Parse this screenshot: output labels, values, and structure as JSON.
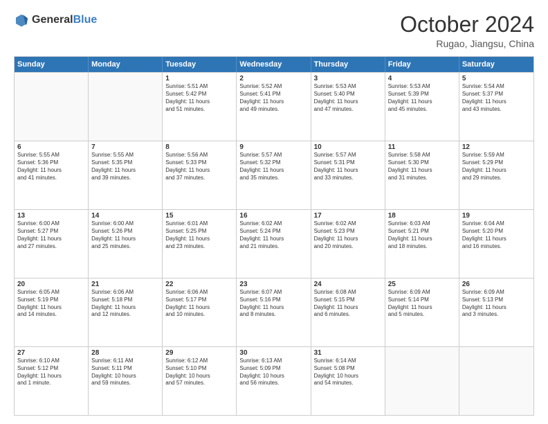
{
  "header": {
    "logo": {
      "general": "General",
      "blue": "Blue"
    },
    "title": "October 2024",
    "location": "Rugao, Jiangsu, China"
  },
  "calendar": {
    "weekdays": [
      "Sunday",
      "Monday",
      "Tuesday",
      "Wednesday",
      "Thursday",
      "Friday",
      "Saturday"
    ],
    "rows": [
      [
        {
          "day": "",
          "empty": true,
          "text": ""
        },
        {
          "day": "",
          "empty": true,
          "text": ""
        },
        {
          "day": "1",
          "text": "Sunrise: 5:51 AM\nSunset: 5:42 PM\nDaylight: 11 hours\nand 51 minutes."
        },
        {
          "day": "2",
          "text": "Sunrise: 5:52 AM\nSunset: 5:41 PM\nDaylight: 11 hours\nand 49 minutes."
        },
        {
          "day": "3",
          "text": "Sunrise: 5:53 AM\nSunset: 5:40 PM\nDaylight: 11 hours\nand 47 minutes."
        },
        {
          "day": "4",
          "text": "Sunrise: 5:53 AM\nSunset: 5:39 PM\nDaylight: 11 hours\nand 45 minutes."
        },
        {
          "day": "5",
          "text": "Sunrise: 5:54 AM\nSunset: 5:37 PM\nDaylight: 11 hours\nand 43 minutes."
        }
      ],
      [
        {
          "day": "6",
          "text": "Sunrise: 5:55 AM\nSunset: 5:36 PM\nDaylight: 11 hours\nand 41 minutes."
        },
        {
          "day": "7",
          "text": "Sunrise: 5:55 AM\nSunset: 5:35 PM\nDaylight: 11 hours\nand 39 minutes."
        },
        {
          "day": "8",
          "text": "Sunrise: 5:56 AM\nSunset: 5:33 PM\nDaylight: 11 hours\nand 37 minutes."
        },
        {
          "day": "9",
          "text": "Sunrise: 5:57 AM\nSunset: 5:32 PM\nDaylight: 11 hours\nand 35 minutes."
        },
        {
          "day": "10",
          "text": "Sunrise: 5:57 AM\nSunset: 5:31 PM\nDaylight: 11 hours\nand 33 minutes."
        },
        {
          "day": "11",
          "text": "Sunrise: 5:58 AM\nSunset: 5:30 PM\nDaylight: 11 hours\nand 31 minutes."
        },
        {
          "day": "12",
          "text": "Sunrise: 5:59 AM\nSunset: 5:29 PM\nDaylight: 11 hours\nand 29 minutes."
        }
      ],
      [
        {
          "day": "13",
          "text": "Sunrise: 6:00 AM\nSunset: 5:27 PM\nDaylight: 11 hours\nand 27 minutes."
        },
        {
          "day": "14",
          "text": "Sunrise: 6:00 AM\nSunset: 5:26 PM\nDaylight: 11 hours\nand 25 minutes."
        },
        {
          "day": "15",
          "text": "Sunrise: 6:01 AM\nSunset: 5:25 PM\nDaylight: 11 hours\nand 23 minutes."
        },
        {
          "day": "16",
          "text": "Sunrise: 6:02 AM\nSunset: 5:24 PM\nDaylight: 11 hours\nand 21 minutes."
        },
        {
          "day": "17",
          "text": "Sunrise: 6:02 AM\nSunset: 5:23 PM\nDaylight: 11 hours\nand 20 minutes."
        },
        {
          "day": "18",
          "text": "Sunrise: 6:03 AM\nSunset: 5:21 PM\nDaylight: 11 hours\nand 18 minutes."
        },
        {
          "day": "19",
          "text": "Sunrise: 6:04 AM\nSunset: 5:20 PM\nDaylight: 11 hours\nand 16 minutes."
        }
      ],
      [
        {
          "day": "20",
          "text": "Sunrise: 6:05 AM\nSunset: 5:19 PM\nDaylight: 11 hours\nand 14 minutes."
        },
        {
          "day": "21",
          "text": "Sunrise: 6:06 AM\nSunset: 5:18 PM\nDaylight: 11 hours\nand 12 minutes."
        },
        {
          "day": "22",
          "text": "Sunrise: 6:06 AM\nSunset: 5:17 PM\nDaylight: 11 hours\nand 10 minutes."
        },
        {
          "day": "23",
          "text": "Sunrise: 6:07 AM\nSunset: 5:16 PM\nDaylight: 11 hours\nand 8 minutes."
        },
        {
          "day": "24",
          "text": "Sunrise: 6:08 AM\nSunset: 5:15 PM\nDaylight: 11 hours\nand 6 minutes."
        },
        {
          "day": "25",
          "text": "Sunrise: 6:09 AM\nSunset: 5:14 PM\nDaylight: 11 hours\nand 5 minutes."
        },
        {
          "day": "26",
          "text": "Sunrise: 6:09 AM\nSunset: 5:13 PM\nDaylight: 11 hours\nand 3 minutes."
        }
      ],
      [
        {
          "day": "27",
          "text": "Sunrise: 6:10 AM\nSunset: 5:12 PM\nDaylight: 11 hours\nand 1 minute."
        },
        {
          "day": "28",
          "text": "Sunrise: 6:11 AM\nSunset: 5:11 PM\nDaylight: 10 hours\nand 59 minutes."
        },
        {
          "day": "29",
          "text": "Sunrise: 6:12 AM\nSunset: 5:10 PM\nDaylight: 10 hours\nand 57 minutes."
        },
        {
          "day": "30",
          "text": "Sunrise: 6:13 AM\nSunset: 5:09 PM\nDaylight: 10 hours\nand 56 minutes."
        },
        {
          "day": "31",
          "text": "Sunrise: 6:14 AM\nSunset: 5:08 PM\nDaylight: 10 hours\nand 54 minutes."
        },
        {
          "day": "",
          "empty": true,
          "text": ""
        },
        {
          "day": "",
          "empty": true,
          "text": ""
        }
      ]
    ]
  }
}
